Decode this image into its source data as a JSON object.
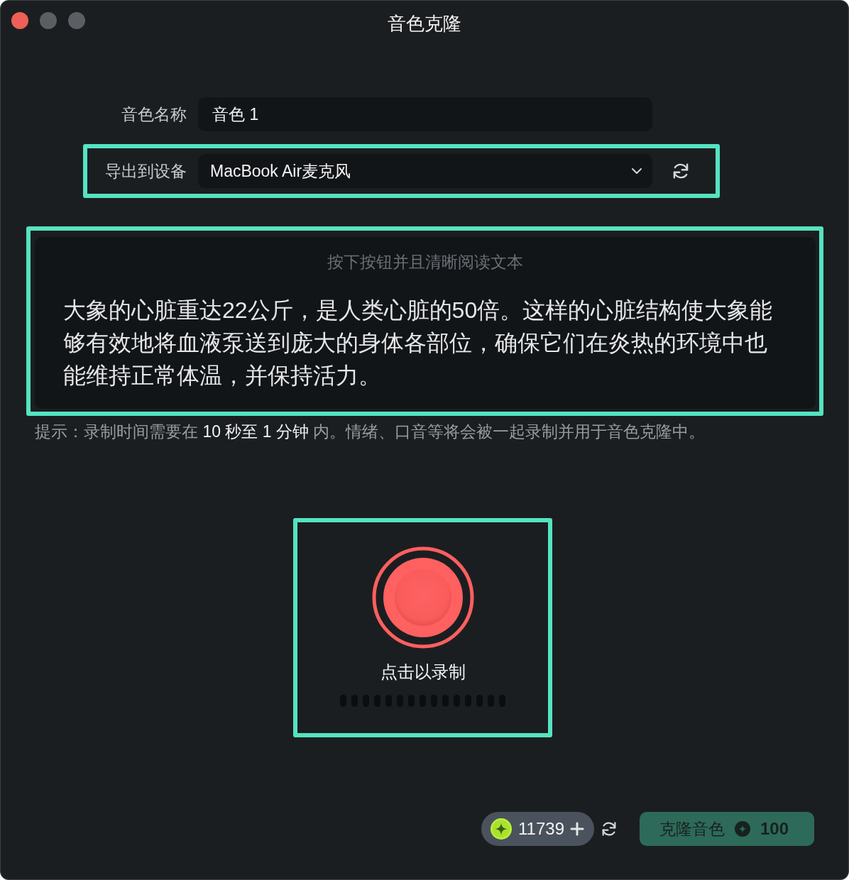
{
  "window": {
    "title": "音色克隆",
    "controls": [
      {
        "kind": "close",
        "disabled": false
      },
      {
        "kind": "minimize",
        "disabled": true
      },
      {
        "kind": "zoom",
        "disabled": true
      }
    ]
  },
  "form": {
    "name_field": {
      "label": "音色名称",
      "value": "音色 1"
    },
    "device_field": {
      "label": "导出到设备",
      "value": "MacBook Air麦克风",
      "highlighted": true
    }
  },
  "reading_panel": {
    "highlighted": true,
    "heading": "按下按钮并且清晰阅读文本",
    "text": "大象的心脏重达22公斤，是人类心脏的50倍。这样的心脏结构使大象能够有效地将血液泵送到庞大的身体各部位，确保它们在炎热的环境中也能维持正常体温，并保持活力。"
  },
  "hint": "提示：录制时间需要在 **10 秒至 1 分钟** 内。情绪、口音等将会被一起录制并用于音色克隆中。",
  "recorder": {
    "highlighted": true,
    "label": "点击以录制"
  },
  "footer": {
    "credits": "11739",
    "clone_button": {
      "label": "克隆音色",
      "cost": "100",
      "disabled": true
    }
  }
}
